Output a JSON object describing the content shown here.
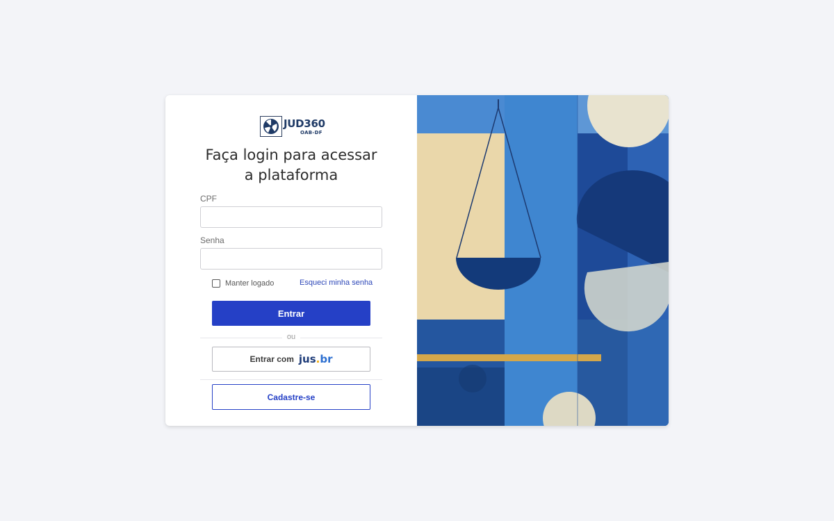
{
  "brand": {
    "name": "JUD360",
    "sub": "OAB-DF"
  },
  "title_line1": "Faça login para acessar",
  "title_line2": "a plataforma",
  "form": {
    "cpf_label": "CPF",
    "cpf_value": "",
    "senha_label": "Senha",
    "senha_value": "",
    "remember_label": "Manter logado",
    "remember_checked": false,
    "forgot_link": "Esqueci minha senha",
    "submit_label": "Entrar"
  },
  "divider_text": "ou",
  "jus_button": {
    "prefix": "Entrar com",
    "logo_part1": "jus",
    "logo_dot": ".",
    "logo_part2": "br"
  },
  "register_label": "Cadastre-se",
  "colors": {
    "primary": "#2540c6",
    "background": "#f3f4f8",
    "jus_navy": "#1d3b78",
    "jus_yellow": "#f2a900",
    "jus_blue": "#2c6fd0"
  },
  "icons": {
    "logo": "scales-emblem-icon",
    "illustration": "justice-scale-illustration"
  }
}
